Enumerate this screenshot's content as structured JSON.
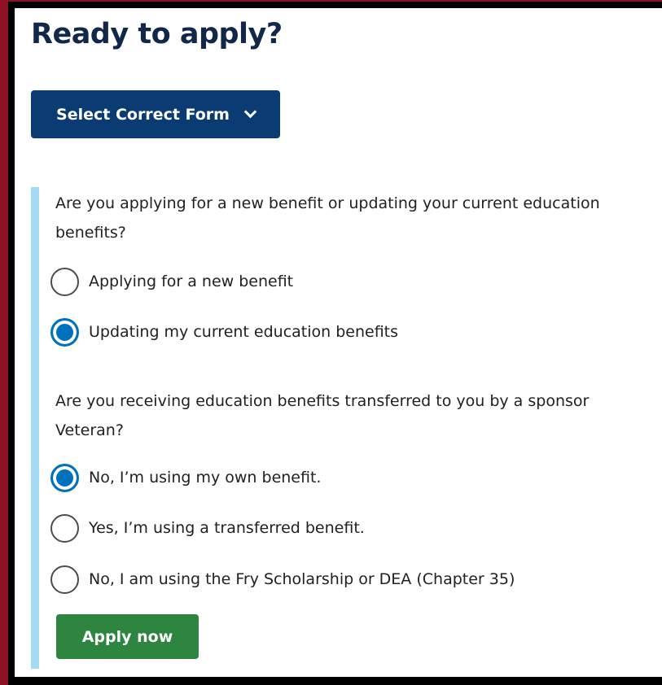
{
  "page": {
    "title": "Ready to apply?"
  },
  "select_form": {
    "label": "Select Correct Form",
    "icon": "chevron-down-icon"
  },
  "wizard": {
    "question1": {
      "text": "Are you applying for a new benefit or updating your current education benefits?",
      "options": [
        {
          "label": "Applying for a new benefit",
          "selected": false
        },
        {
          "label": "Updating my current education benefits",
          "selected": true
        }
      ]
    },
    "question2": {
      "text": "Are you receiving education benefits transferred to you by a sponsor Veteran?",
      "options": [
        {
          "label": "No, I’m using my own benefit.",
          "selected": true
        },
        {
          "label": "Yes, I’m using a transferred benefit.",
          "selected": false
        },
        {
          "label": "No, I am using the Fry Scholarship or DEA (Chapter 35)",
          "selected": false
        }
      ]
    },
    "apply_button": "Apply now"
  },
  "colors": {
    "background": "#8c1122",
    "title": "#12284b",
    "select_button": "#0b3b73",
    "wizard_border": "#a3dbf4",
    "radio_selected": "#0071bc",
    "apply_button": "#2e8540"
  }
}
